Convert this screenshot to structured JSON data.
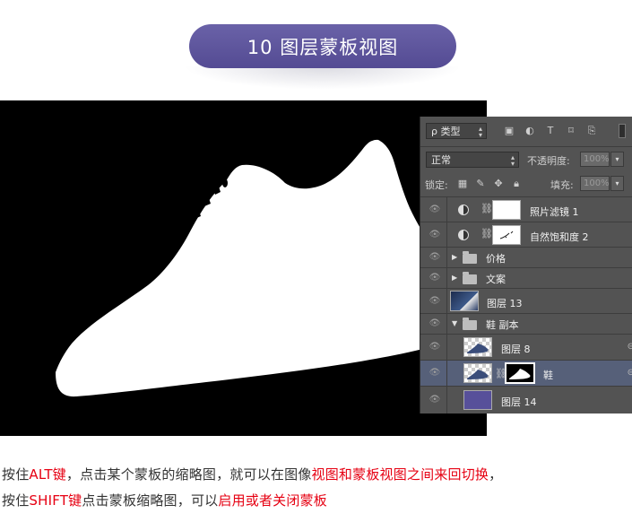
{
  "title": "10 图层蒙板视图",
  "layers_panel": {
    "filter_label": "ρ 类型",
    "blend_mode": "正常",
    "opacity_label": "不透明度:",
    "opacity_value": "100%",
    "lock_label": "锁定:",
    "fill_label": "填充:",
    "fill_value": "100%",
    "layers": [
      {
        "name": "照片滤镜 1",
        "kind": "adjustment"
      },
      {
        "name": "自然饱和度 2",
        "kind": "adjustment"
      },
      {
        "name": "价格",
        "kind": "group-collapsed"
      },
      {
        "name": "文案",
        "kind": "group-collapsed"
      },
      {
        "name": "图层 13",
        "kind": "image"
      },
      {
        "name": "鞋 副本",
        "kind": "group-expanded"
      },
      {
        "name": "图层 8",
        "kind": "image"
      },
      {
        "name": "鞋",
        "kind": "masked-image",
        "selected": true
      },
      {
        "name": "图层 14",
        "kind": "fill"
      }
    ]
  },
  "caption": {
    "line1": [
      {
        "text": "按住",
        "red": false
      },
      {
        "text": "ALT键",
        "red": true
      },
      {
        "text": "，点击某个蒙板的缩略图，就可以在图像",
        "red": false
      },
      {
        "text": "视图和蒙板视图之间来回切换",
        "red": true
      },
      {
        "text": "，",
        "red": false
      }
    ],
    "line2": [
      {
        "text": "按住",
        "red": false
      },
      {
        "text": "SHIFT键",
        "red": true
      },
      {
        "text": "点击蒙板缩略图，可以",
        "red": false
      },
      {
        "text": "启用或者关闭蒙板",
        "red": true
      }
    ]
  },
  "colors": {
    "title_pill": "#5a5199",
    "highlight": "#e60012",
    "panel_bg": "#535353",
    "selected_layer": "#566079",
    "layer14_swatch": "#57509a"
  },
  "icons": [
    "eye-icon",
    "chain-link-icon",
    "folder-icon",
    "lock-icon",
    "brush-icon",
    "move-icon",
    "image-filter-icon",
    "adjustment-filter-icon",
    "text-filter-icon",
    "shape-filter-icon",
    "smart-object-filter-icon"
  ]
}
